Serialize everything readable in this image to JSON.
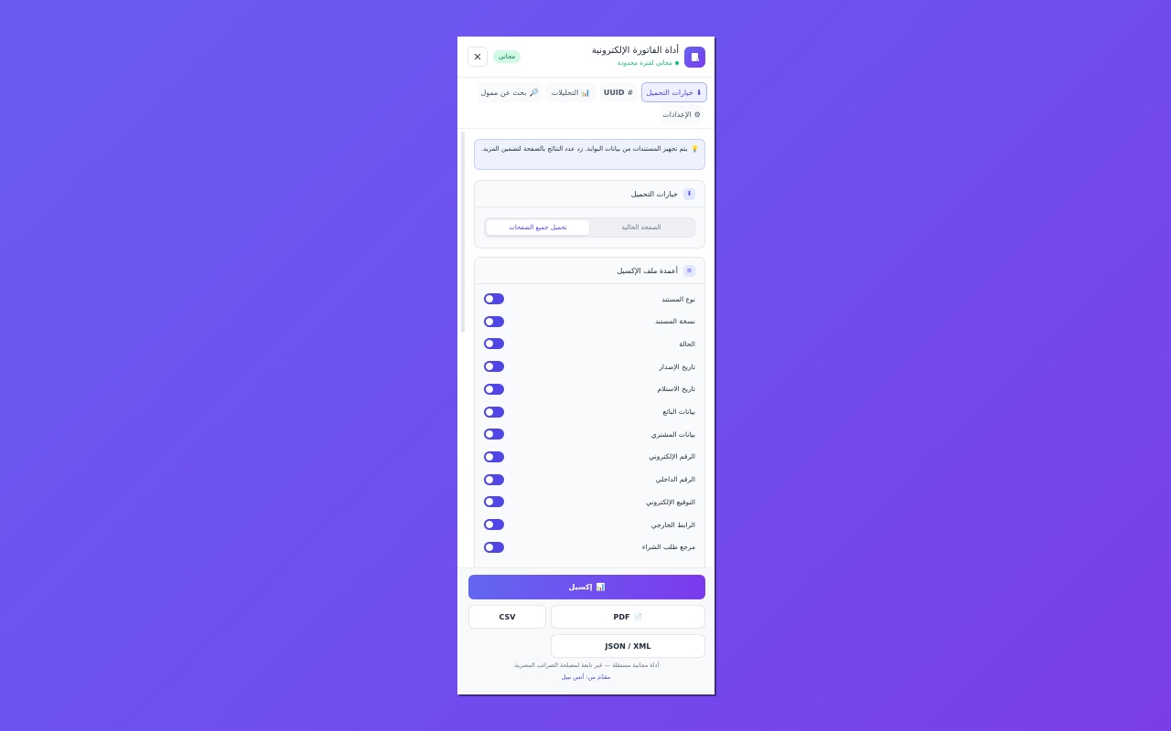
{
  "header": {
    "title": "أداة الفاتورة الإلكترونية",
    "subtitle": "مجاني لفترة محدودة",
    "badge": "مجاني",
    "accent": "#6366f1"
  },
  "tabs": [
    {
      "label": "خيارات التحميل",
      "icon": "download-icon",
      "active": true
    },
    {
      "label": "UUID",
      "icon": "hash-icon",
      "active": false
    },
    {
      "label": "التحليلات",
      "icon": "chart-icon",
      "active": false
    },
    {
      "label": "بحث عن ممول",
      "icon": "search-icon",
      "active": false
    },
    {
      "label": "الإعدادات",
      "icon": "gear-icon",
      "active": false
    }
  ],
  "info_text": "يتم تجهيز المستندات من بيانات البوابة. زد عدد النتائج بالصفحة لتضمين المزيد.",
  "download_options": {
    "title": "خيارات التحميل",
    "options": [
      "الصفحة الحالية",
      "تحميل جميع الصفحات"
    ],
    "selected": "تحميل جميع الصفحات"
  },
  "excel_columns": {
    "title": "أعمدة ملف الإكسيل",
    "items": [
      {
        "label": "نوع المستند",
        "on": true
      },
      {
        "label": "نسخة المستند",
        "on": true
      },
      {
        "label": "الحالة",
        "on": true
      },
      {
        "label": "تاريخ الإصدار",
        "on": true
      },
      {
        "label": "تاريخ الاستلام",
        "on": true
      },
      {
        "label": "بيانات البائع",
        "on": true
      },
      {
        "label": "بيانات المشتري",
        "on": true
      },
      {
        "label": "الرقم الإلكتروني",
        "on": true
      },
      {
        "label": "الرقم الداخلي",
        "on": true
      },
      {
        "label": "التوقيع الإلكتروني",
        "on": true
      },
      {
        "label": "الرابط الخارجي",
        "on": true
      },
      {
        "label": "مرجع طلب الشراء",
        "on": true
      }
    ]
  },
  "footer": {
    "excel": "إكسيل",
    "pdf": "PDF",
    "csv": "CSV",
    "json_xml": "JSON / XML",
    "note": "أداة مجانية مستقلة — غير تابعة لمصلحة الضرائب المصرية.",
    "credit": "مقدّم من: أنس نبيل"
  }
}
